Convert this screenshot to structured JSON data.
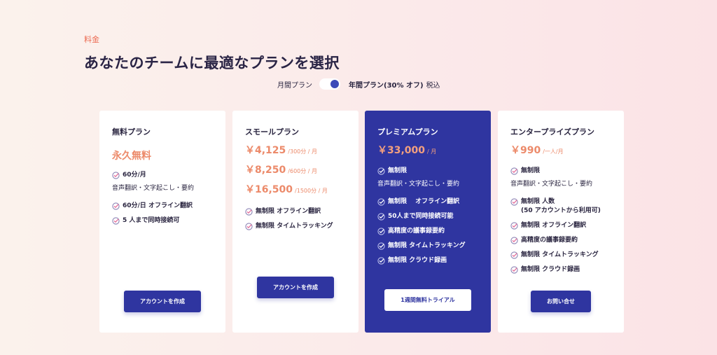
{
  "header": {
    "section_label": "料金",
    "title": "あなたのチームに最適なプランを選択"
  },
  "billing_toggle": {
    "monthly_label": "月間プラン",
    "annual_label": "年間プラン(30% オフ)",
    "tax_label": "税込",
    "selected": "annual"
  },
  "colors": {
    "accent": "#2f35a0",
    "price": "#ec8a6a",
    "check": "#e46d9a"
  },
  "plans": {
    "free": {
      "title": "無料プラン",
      "price": "永久無料",
      "feature_1": "60分/月",
      "note": "音声翻訳・文字起こし・要約",
      "feature_2": "60分/日 オフライン翻訳",
      "feature_3": "5 人まで同時接続可",
      "cta": "アカウントを作成"
    },
    "small": {
      "title": "スモールプラン",
      "tiers": [
        {
          "price": "￥4,125",
          "unit": "/300分 / 月"
        },
        {
          "price": "￥8,250",
          "unit": "/600分 / 月"
        },
        {
          "price": "￥16,500",
          "unit": "/1500分 / 月"
        }
      ],
      "feature_1": "無制限 オフライン翻訳",
      "feature_2": "無制限 タイムトラッキング",
      "cta": "アカウントを作成"
    },
    "premium": {
      "title": "プレミアムプラン",
      "price": "￥33,000",
      "unit": "/ 月",
      "feature_1": "無制限",
      "note": "音声翻訳・文字起こし・要約",
      "feature_2": "無制限　 オフライン翻訳",
      "feature_3": "50人まで同時接続可能",
      "feature_4": "高精度の議事録要約",
      "feature_5": "無制限 タイムトラッキング",
      "feature_6": "無制限 クラウド録画",
      "cta": "1週間無料トライアル"
    },
    "enterprise": {
      "title": "エンタープライズプラン",
      "price": "￥990",
      "unit": "/一人/月",
      "feature_1": "無制限",
      "note": "音声翻訳・文字起こし・要約",
      "feature_2": "無制限 人数",
      "feature_2_sub": "(50 アカウントから利用可)",
      "feature_3": "無制限 オフライン翻訳",
      "feature_4": "高精度の議事録要約",
      "feature_5": "無制限 タイムトラッキング",
      "feature_6": "無制限 クラウド録画",
      "cta": "お問い合せ"
    }
  }
}
